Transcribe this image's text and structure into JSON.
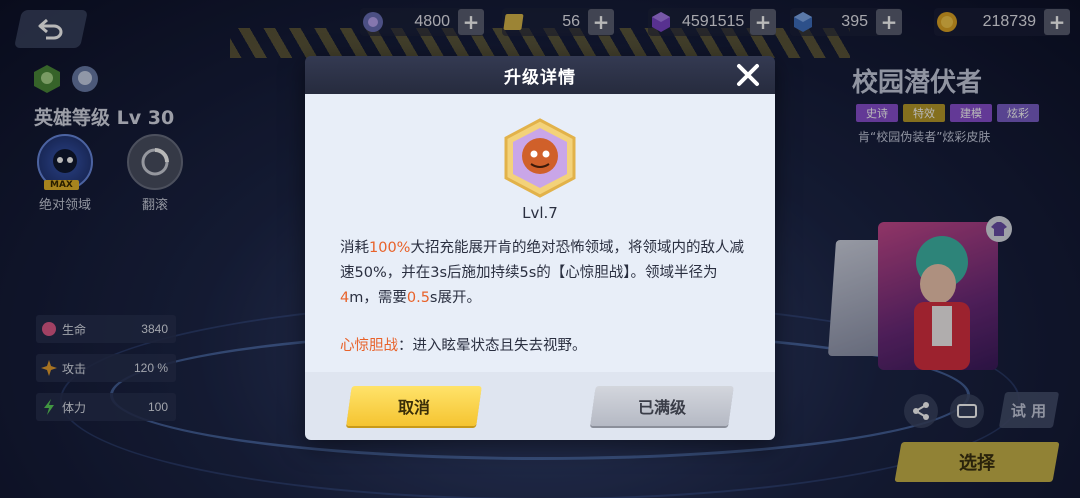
{
  "top_bar": {
    "resources": [
      {
        "icon": "purple-token-icon",
        "value": "4800"
      },
      {
        "icon": "ticket-card-icon",
        "value": "56"
      },
      {
        "icon": "purple-cube-icon",
        "value": "4591515"
      },
      {
        "icon": "blue-gem-icon",
        "value": "395"
      },
      {
        "icon": "gold-coin-icon",
        "value": "218739"
      }
    ]
  },
  "left_panel": {
    "hero_level": "英雄等级 Lv 30",
    "skills": [
      {
        "label": "绝对领域",
        "badge": "MAX"
      },
      {
        "label": "翻滚"
      }
    ],
    "stats": [
      {
        "label": "生命",
        "value": "3840"
      },
      {
        "label": "攻击",
        "value": "120 %"
      },
      {
        "label": "体力",
        "value": "100"
      }
    ]
  },
  "right_panel": {
    "skin_name": "校园潜伏者",
    "tags": [
      {
        "label": "史诗",
        "color": "#8a4fd0"
      },
      {
        "label": "特效",
        "color": "#b89a2a"
      },
      {
        "label": "建模",
        "color": "#8a4fd0"
      },
      {
        "label": "炫彩",
        "color": "#7a5fc8"
      }
    ],
    "description": "肯“校园伪装者”炫彩皮肤",
    "try_label": "试 用",
    "select_label": "选择"
  },
  "modal": {
    "title": "升级详情",
    "level": "Lvl.7",
    "desc": {
      "p1": "消耗",
      "h1": "100%",
      "p2": "大招充能展开肯的绝对恐怖领域，将领域内的敌人减速50%，并在3s后施加持续5s的【心惊胆战】。领域半径为",
      "h2": "4",
      "p3": "m，需要",
      "h3": "0.5",
      "p4": "s展开。"
    },
    "effect_name": "心惊胆战",
    "effect_text": "：进入眩晕状态且失去视野。",
    "cancel_label": "取消",
    "max_label": "已满级"
  },
  "colors": {
    "highlight": "#e8622a",
    "cancel_button": "#f5c431",
    "max_button": "#b5b9c4"
  }
}
